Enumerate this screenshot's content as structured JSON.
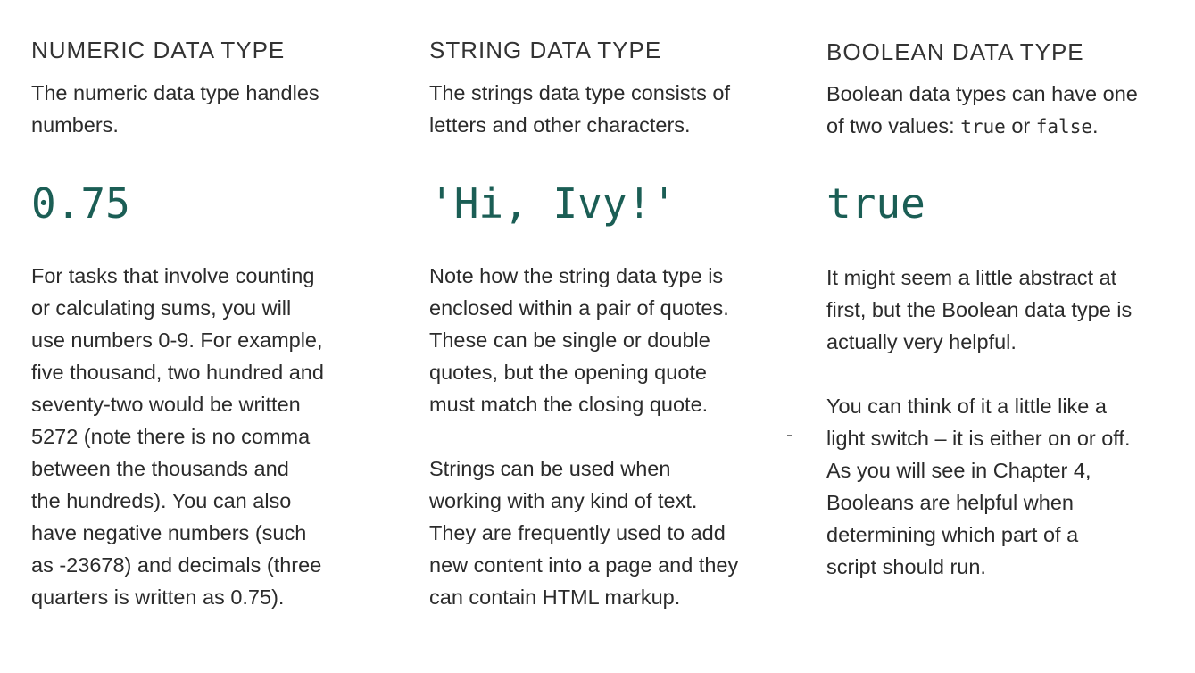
{
  "columns": {
    "numeric": {
      "heading": "NUMERIC DATA TYPE",
      "intro": "The numeric data type handles numbers.",
      "intro_lines": [
        "The numeric data type handles",
        "numbers."
      ],
      "example": "0.75",
      "body_lines": [
        "For tasks that involve counting",
        "or calculating sums, you will",
        "use numbers 0-9. For example,",
        "five thousand, two hundred and",
        "seventy-two would be written",
        "5272 (note there is no comma",
        "between the thousands and",
        "the hundreds). You can also",
        "have negative numbers (such",
        "as -23678) and decimals (three",
        "quarters is written as 0.75)."
      ]
    },
    "string": {
      "heading": "STRING DATA TYPE",
      "intro_lines": [
        "The strings data type consists of",
        "letters and other characters."
      ],
      "example": "'Hi, Ivy!'",
      "body_para1_lines": [
        "Note how the string data type is",
        "enclosed within a pair of quotes.",
        "These can be single or double",
        "quotes, but the opening quote",
        "must match the closing quote."
      ],
      "body_para2_lines": [
        "Strings can be used when",
        "working with any kind of text.",
        "They are frequently used to add",
        "new content into a page and they",
        "can contain HTML markup."
      ]
    },
    "boolean": {
      "heading": "BOOLEAN DATA TYPE",
      "intro_line1": "Boolean data types can have one",
      "intro_line2_prefix": "of two values: ",
      "intro_true": "true",
      "intro_or": " or ",
      "intro_false": "false",
      "intro_period": ".",
      "example": "true",
      "body_para1_lines": [
        "It might seem a little abstract at",
        "first, but the Boolean data type is",
        "actually very helpful."
      ],
      "body_para2_lines": [
        "You can think of it a little like a",
        "light switch – it is either on or off.",
        "As you will see in Chapter 4,",
        "Booleans are helpful when",
        "determining which part of a",
        "script should run."
      ]
    }
  },
  "colors": {
    "example_text": "#1b5e55",
    "body_text": "#2b2b2b"
  }
}
